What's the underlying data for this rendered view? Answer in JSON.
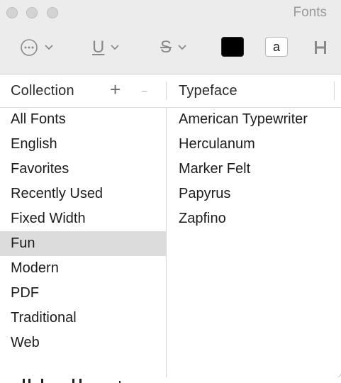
{
  "window": {
    "title": "Fonts"
  },
  "toolbar": {
    "actions_icon": "ellipsis-circle-icon",
    "underline_glyph": "U",
    "strikethrough_glyph": "S",
    "text_color": "#000000",
    "document_color_label": "a",
    "spacing_icon": "spacing-icon"
  },
  "collection": {
    "header": "Collection",
    "add_label": "+",
    "remove_label": "−",
    "items": [
      {
        "label": "All Fonts"
      },
      {
        "label": "English"
      },
      {
        "label": "Favorites"
      },
      {
        "label": "Recently Used"
      },
      {
        "label": "Fixed Width"
      },
      {
        "label": "Fun"
      },
      {
        "label": "Modern"
      },
      {
        "label": "PDF"
      },
      {
        "label": "Traditional"
      },
      {
        "label": "Web"
      }
    ],
    "selected": "Fun"
  },
  "typeface": {
    "header": "Typeface",
    "items": [
      {
        "label": "American Typewriter"
      },
      {
        "label": "Herculanum"
      },
      {
        "label": "Marker Felt"
      },
      {
        "label": "Papyrus"
      },
      {
        "label": "Zapfino"
      }
    ]
  }
}
